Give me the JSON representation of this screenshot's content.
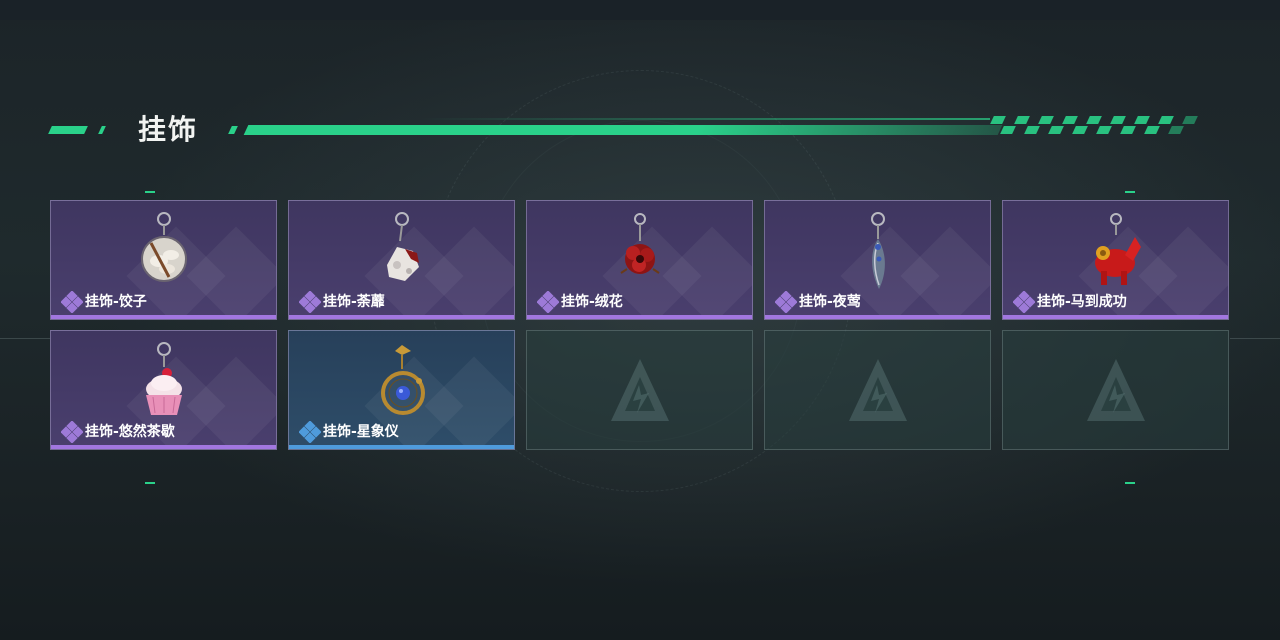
{
  "section": {
    "title": "挂饰"
  },
  "items": [
    {
      "label": "挂饰-饺子",
      "rarity": "purple",
      "icon": "dumpling-charm-icon"
    },
    {
      "label": "挂饰-荼蘼",
      "rarity": "purple",
      "icon": "flower-skull-charm-icon"
    },
    {
      "label": "挂饰-绒花",
      "rarity": "purple",
      "icon": "red-flower-charm-icon"
    },
    {
      "label": "挂饰-夜莺",
      "rarity": "purple",
      "icon": "feather-charm-icon"
    },
    {
      "label": "挂饰-马到成功",
      "rarity": "purple",
      "icon": "red-horse-charm-icon"
    },
    {
      "label": "挂饰-悠然茶歇",
      "rarity": "purple",
      "icon": "cupcake-charm-icon"
    },
    {
      "label": "挂饰-星象仪",
      "rarity": "blue",
      "icon": "astrolabe-charm-icon"
    }
  ],
  "empty_slots": 3,
  "colors": {
    "accent": "#2ad18a",
    "purple_rarity": "#a277e0",
    "blue_rarity": "#4f9bdc"
  }
}
